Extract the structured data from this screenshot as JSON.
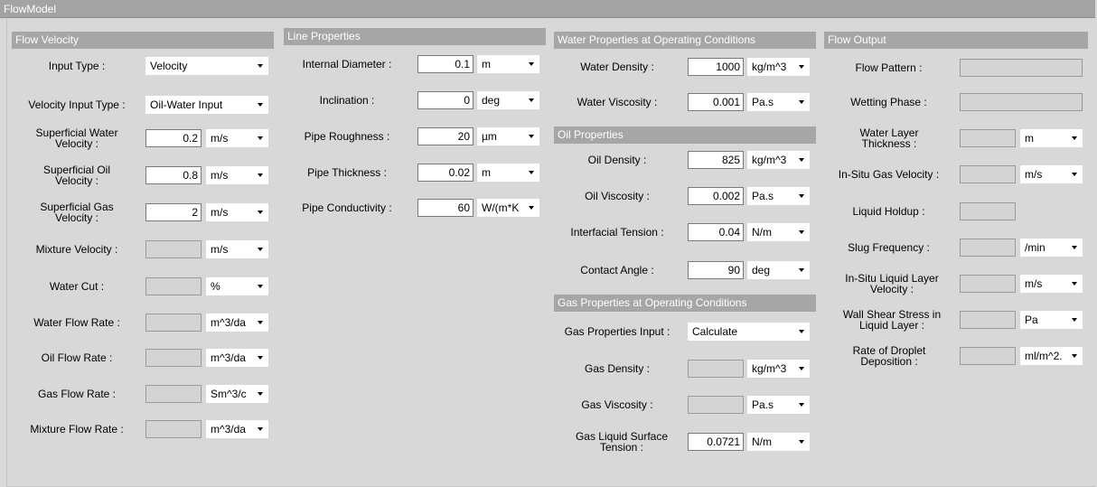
{
  "window": {
    "title": "FlowModel"
  },
  "flow_velocity": {
    "header": "Flow Velocity",
    "input_type": {
      "label": "Input Type :",
      "value": "Velocity"
    },
    "velocity_input_type": {
      "label": "Velocity Input Type :",
      "value": "Oil-Water Input"
    },
    "sup_water": {
      "label": "Superficial Water Velocity :",
      "value": "0.2",
      "unit": "m/s"
    },
    "sup_oil": {
      "label": "Superficial Oil Velocity :",
      "value": "0.8",
      "unit": "m/s"
    },
    "sup_gas": {
      "label": "Superficial Gas Velocity :",
      "value": "2",
      "unit": "m/s"
    },
    "mixture_velocity": {
      "label": "Mixture Velocity :",
      "value": "",
      "unit": "m/s"
    },
    "water_cut": {
      "label": "Water Cut :",
      "value": "",
      "unit": "%"
    },
    "water_flow_rate": {
      "label": "Water Flow Rate :",
      "value": "",
      "unit": "m^3/da"
    },
    "oil_flow_rate": {
      "label": "Oil Flow Rate :",
      "value": "",
      "unit": "m^3/da"
    },
    "gas_flow_rate": {
      "label": "Gas Flow Rate :",
      "value": "",
      "unit": "Sm^3/c"
    },
    "mixture_flow_rate": {
      "label": "Mixture Flow Rate :",
      "value": "",
      "unit": "m^3/da"
    }
  },
  "line_properties": {
    "header": "Line Properties",
    "internal_diameter": {
      "label": "Internal Diameter :",
      "value": "0.1",
      "unit": "m"
    },
    "inclination": {
      "label": "Inclination :",
      "value": "0",
      "unit": "deg"
    },
    "pipe_roughness": {
      "label": "Pipe Roughness :",
      "value": "20",
      "unit": "µm"
    },
    "pipe_thickness": {
      "label": "Pipe Thickness :",
      "value": "0.02",
      "unit": "m"
    },
    "pipe_conductivity": {
      "label": "Pipe Conductivity :",
      "value": "60",
      "unit": "W/(m*K"
    }
  },
  "water_properties": {
    "header": "Water Properties at Operating Conditions",
    "water_density": {
      "label": "Water Density :",
      "value": "1000",
      "unit": "kg/m^3"
    },
    "water_viscosity": {
      "label": "Water Viscosity :",
      "value": "0.001",
      "unit": "Pa.s"
    }
  },
  "oil_properties": {
    "header": "Oil Properties",
    "oil_density": {
      "label": "Oil Density :",
      "value": "825",
      "unit": "kg/m^3"
    },
    "oil_viscosity": {
      "label": "Oil Viscosity :",
      "value": "0.002",
      "unit": "Pa.s"
    },
    "interfacial_tension": {
      "label": "Interfacial Tension :",
      "value": "0.04",
      "unit": "N/m"
    },
    "contact_angle": {
      "label": "Contact Angle :",
      "value": "90",
      "unit": "deg"
    }
  },
  "gas_properties": {
    "header": "Gas Properties at Operating Conditions",
    "gas_input": {
      "label": "Gas Properties Input :",
      "value": "Calculate"
    },
    "gas_density": {
      "label": "Gas Density :",
      "value": "",
      "unit": "kg/m^3"
    },
    "gas_viscosity": {
      "label": "Gas Viscosity :",
      "value": "",
      "unit": "Pa.s"
    },
    "gas_liquid_tension": {
      "label": "Gas Liquid Surface Tension :",
      "value": "0.0721",
      "unit": "N/m"
    }
  },
  "flow_output": {
    "header": "Flow Output",
    "flow_pattern": {
      "label": "Flow Pattern :",
      "value": ""
    },
    "wetting_phase": {
      "label": "Wetting Phase :",
      "value": ""
    },
    "water_layer_thickness": {
      "label": "Water Layer Thickness :",
      "value": "",
      "unit": "m"
    },
    "insitu_gas_velocity": {
      "label": "In-Situ Gas Velocity :",
      "value": "",
      "unit": "m/s"
    },
    "liquid_holdup": {
      "label": "Liquid Holdup :",
      "value": ""
    },
    "slug_frequency": {
      "label": "Slug Frequency :",
      "value": "",
      "unit": "/min"
    },
    "insitu_liquid_velocity": {
      "label": "In-Situ Liquid Layer Velocity :",
      "value": "",
      "unit": "m/s"
    },
    "wall_shear_stress": {
      "label": "Wall Shear Stress in Liquid Layer :",
      "value": "",
      "unit": "Pa"
    },
    "droplet_deposition": {
      "label": "Rate of Droplet Deposition :",
      "value": "",
      "unit": "ml/m^2."
    }
  }
}
